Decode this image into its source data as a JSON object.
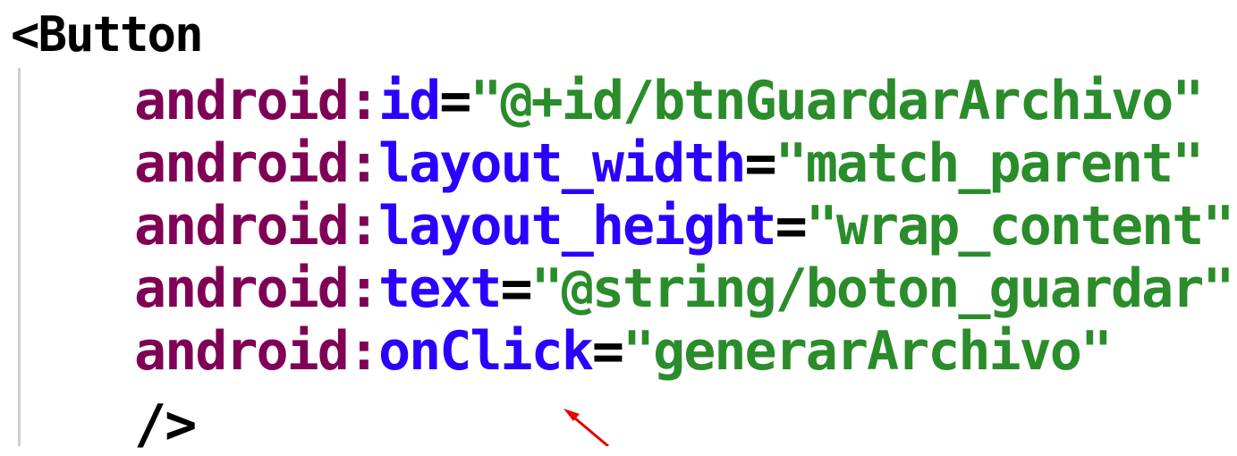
{
  "code": {
    "tag_open": "<Button",
    "attributes": [
      {
        "namespace": "android",
        "colon": ":",
        "name": "id",
        "equals": "=",
        "value": "\"@+id/btnGuardarArchivo\""
      },
      {
        "namespace": "android",
        "colon": ":",
        "name": "layout_width",
        "equals": "=",
        "value": "\"match_parent\""
      },
      {
        "namespace": "android",
        "colon": ":",
        "name": "layout_height",
        "equals": "=",
        "value": "\"wrap_content\""
      },
      {
        "namespace": "android",
        "colon": ":",
        "name": "text",
        "equals": "=",
        "value": "\"@string/boton_guardar\""
      },
      {
        "namespace": "android",
        "colon": ":",
        "name": "onClick",
        "equals": "=",
        "value": "\"generarArchivo\""
      }
    ],
    "tag_close": "/>"
  },
  "colors": {
    "namespace": "#7f0055",
    "attribute": "#2a00ff",
    "value": "#2a8c2a",
    "tag": "#000000",
    "arrow": "#e60000"
  },
  "annotation": {
    "icon": "red-arrow-icon"
  }
}
